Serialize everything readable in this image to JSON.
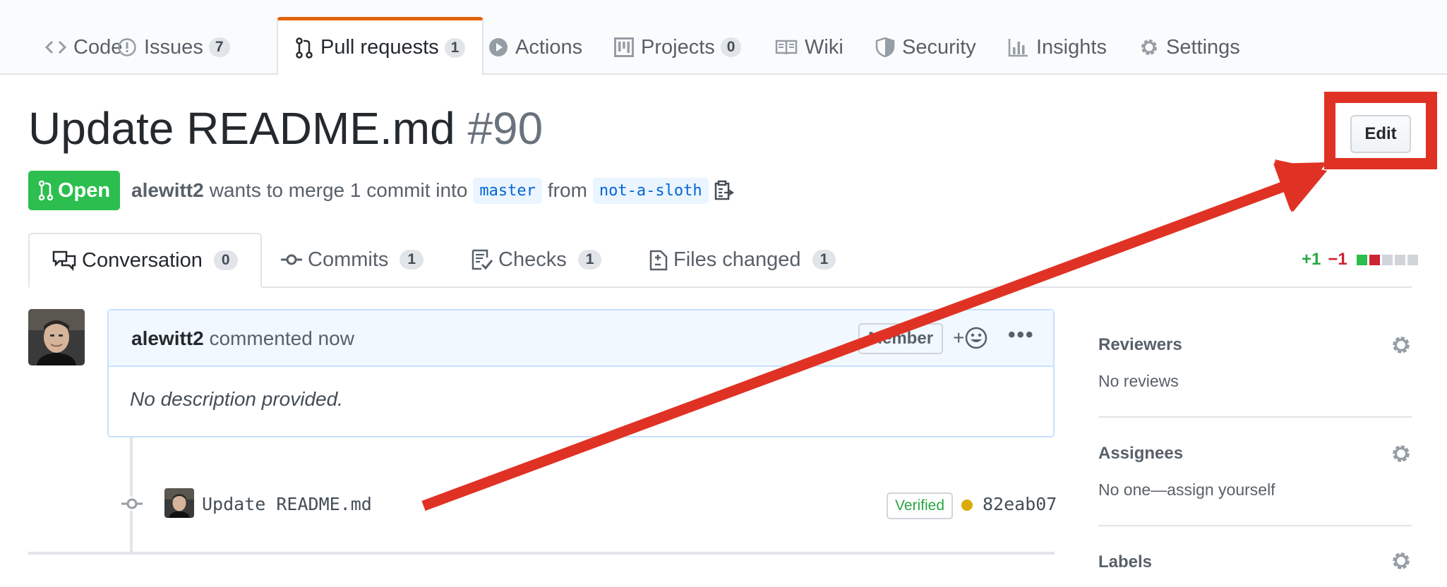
{
  "repo_nav": {
    "tabs": [
      {
        "label": "Code",
        "count": null
      },
      {
        "label": "Issues",
        "count": "7"
      },
      {
        "label": "Pull requests",
        "count": "1",
        "selected": true
      },
      {
        "label": "Actions",
        "count": null
      },
      {
        "label": "Projects",
        "count": "0"
      },
      {
        "label": "Wiki",
        "count": null
      },
      {
        "label": "Security",
        "count": null
      },
      {
        "label": "Insights",
        "count": null
      },
      {
        "label": "Settings",
        "count": null
      }
    ]
  },
  "pr": {
    "title": "Update README.md",
    "number": "#90",
    "edit_label": "Edit",
    "state": "Open",
    "author": "alewitt2",
    "merge_text": "wants to merge 1 commit into",
    "base_branch": "master",
    "from_text": "from",
    "head_branch": "not-a-sloth"
  },
  "pr_tabs": [
    {
      "label": "Conversation",
      "count": "0",
      "icon": "comment-discussion-icon"
    },
    {
      "label": "Commits",
      "count": "1",
      "icon": "git-commit-icon"
    },
    {
      "label": "Checks",
      "count": "1",
      "icon": "checklist-icon"
    },
    {
      "label": "Files changed",
      "count": "1",
      "icon": "file-diff-icon"
    }
  ],
  "diffstat": {
    "additions": "+1",
    "deletions": "−1"
  },
  "comment": {
    "author": "alewitt2",
    "action": "commented now",
    "badge": "Member",
    "reaction_label": "+",
    "more_label": "•••",
    "body": "No description provided."
  },
  "commit": {
    "message": "Update README.md",
    "verified": "Verified",
    "sha": "82eab07"
  },
  "sidebar": {
    "reviewers": {
      "title": "Reviewers",
      "value": "No reviews"
    },
    "assignees": {
      "title": "Assignees",
      "value": "No one—assign yourself"
    },
    "labels": {
      "title": "Labels"
    }
  },
  "colors": {
    "accent_tab": "#e36209",
    "open_green": "#2cbe4e",
    "annotation_red": "#e03224",
    "link_blue": "#0366d6"
  }
}
